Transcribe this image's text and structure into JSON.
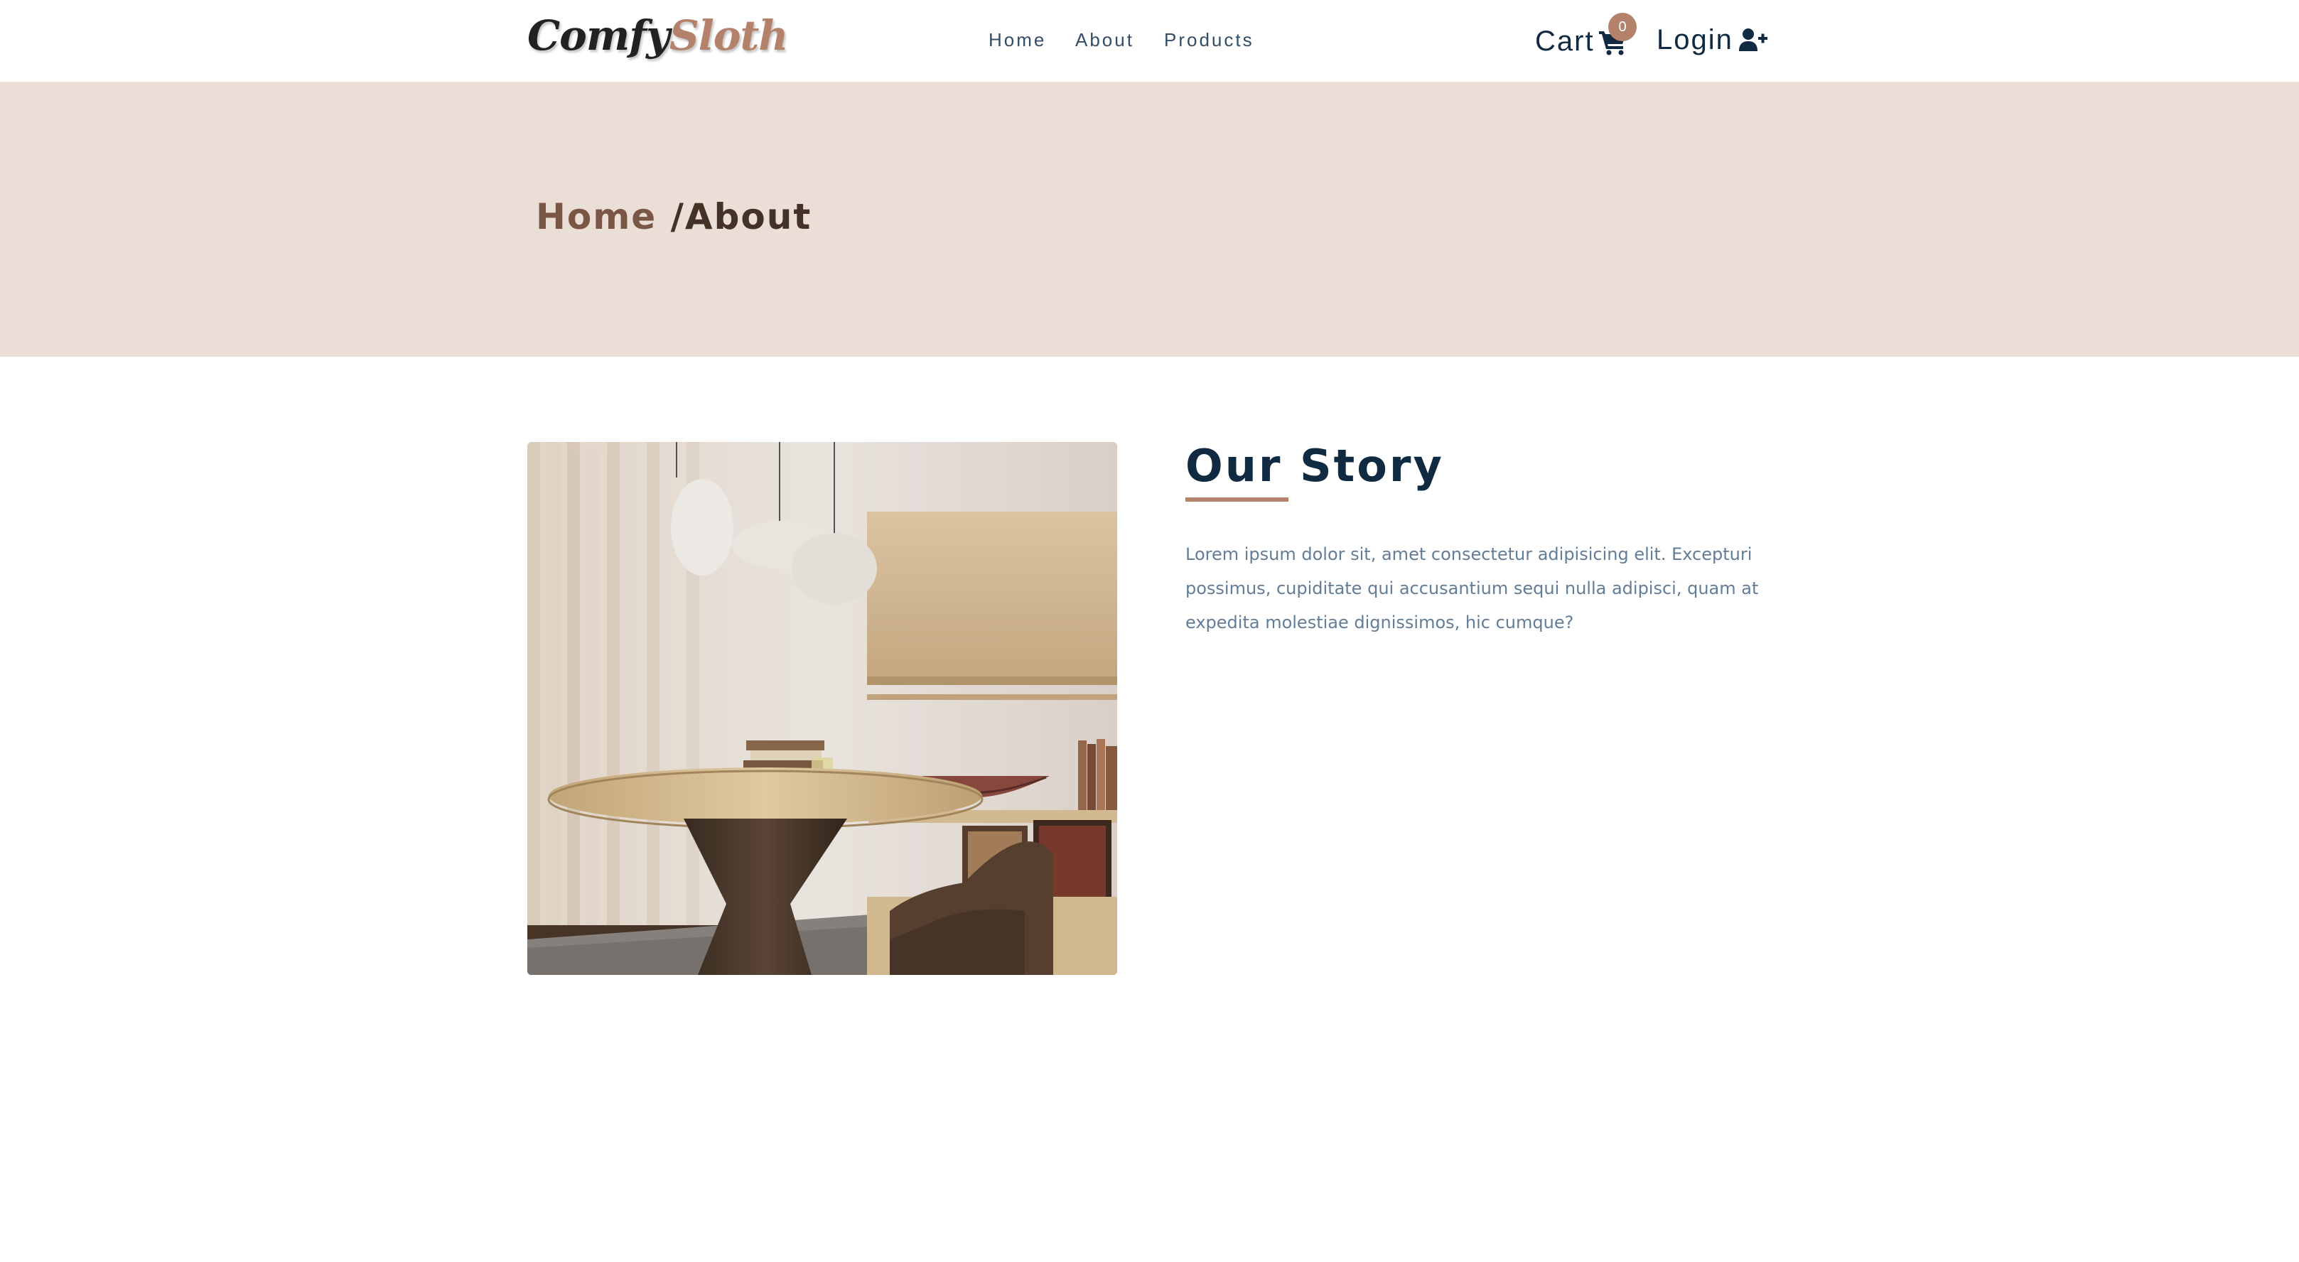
{
  "brand": {
    "part1": "Comfy",
    "part2": "Sloth"
  },
  "nav": {
    "home": "Home",
    "about": "About",
    "products": "Products"
  },
  "cart": {
    "label": "Cart",
    "count": "0",
    "icon": "shopping-cart-icon"
  },
  "login": {
    "label": "Login",
    "icon": "user-plus-icon"
  },
  "breadcrumb": {
    "home": "Home",
    "current": "/About"
  },
  "story": {
    "title": "Our Story",
    "text": "Lorem ipsum dolor sit, amet consectetur adipisicing elit. Excepturi possimus, cupiditate qui accusantium sequi nulla adipisci, quam at expedita molestiae dignissimos, hic cumque?",
    "image": "room-with-round-table-photo"
  },
  "colors": {
    "accent": "#b4826a",
    "hero_bg": "#eaded7",
    "heading": "#102a42",
    "crumb_home": "#795744",
    "crumb_current": "#453227",
    "body_text": "#617d98"
  }
}
